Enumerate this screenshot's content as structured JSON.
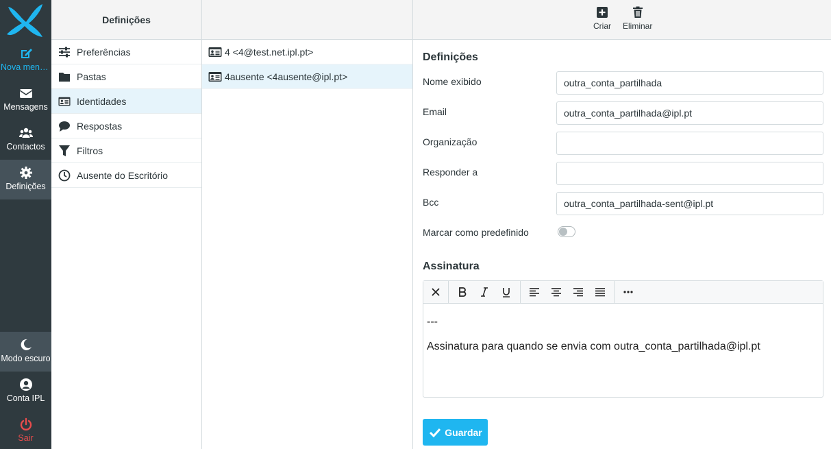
{
  "nav": {
    "compose": "Nova mens...",
    "mail": "Mensagens",
    "contacts": "Contactos",
    "settings": "Definições",
    "darkmode": "Modo escuro",
    "account": "Conta IPL",
    "logout": "Sair"
  },
  "settings_menu": {
    "header": "Definições",
    "items": [
      {
        "label": "Preferências",
        "icon": "sliders-icon"
      },
      {
        "label": "Pastas",
        "icon": "folder-icon"
      },
      {
        "label": "Identidades",
        "icon": "id-card-icon"
      },
      {
        "label": "Respostas",
        "icon": "comment-icon"
      },
      {
        "label": "Filtros",
        "icon": "filter-icon"
      },
      {
        "label": "Ausente do Escritório",
        "icon": "clock-icon"
      }
    ]
  },
  "identities": [
    {
      "label": "4 <4@test.net.ipl.pt>"
    },
    {
      "label": "4ausente <4ausente@ipl.pt>"
    }
  ],
  "toolbar": {
    "create": "Criar",
    "delete": "Eliminar"
  },
  "form": {
    "section_title": "Definições",
    "name_label": "Nome exibido",
    "name_value": "outra_conta_partilhada",
    "email_label": "Email",
    "email_value": "outra_conta_partilhada@ipl.pt",
    "org_label": "Organização",
    "org_value": "",
    "reply_label": "Responder a",
    "reply_value": "",
    "bcc_label": "Bcc",
    "bcc_value": "outra_conta_partilhada-sent@ipl.pt",
    "default_label": "Marcar como predefinido",
    "default_on": false
  },
  "signature": {
    "section_title": "Assinatura",
    "line1": "---",
    "line2": "Assinatura para quando se envia com outra_conta_partilhada@ipl.pt"
  },
  "save_label": "Guardar",
  "colors": {
    "accent": "#1fb6f0",
    "rail": "#2f3a3f",
    "danger": "#e84c4c"
  }
}
